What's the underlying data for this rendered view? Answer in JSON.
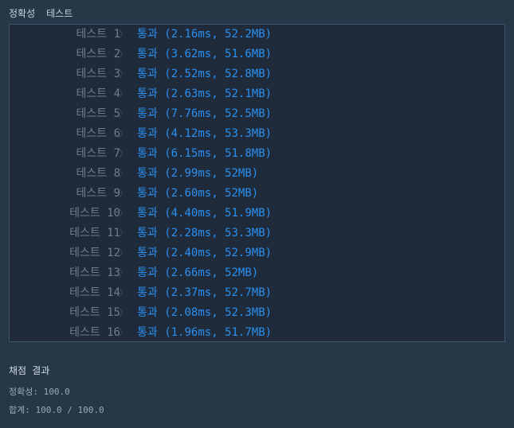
{
  "header": {
    "tabs": [
      "정확성",
      "테스트"
    ]
  },
  "tests": [
    {
      "name": "테스트 1",
      "result": "통과 (2.16ms, 52.2MB)"
    },
    {
      "name": "테스트 2",
      "result": "통과 (3.62ms, 51.6MB)"
    },
    {
      "name": "테스트 3",
      "result": "통과 (2.52ms, 52.8MB)"
    },
    {
      "name": "테스트 4",
      "result": "통과 (2.63ms, 52.1MB)"
    },
    {
      "name": "테스트 5",
      "result": "통과 (7.76ms, 52.5MB)"
    },
    {
      "name": "테스트 6",
      "result": "통과 (4.12ms, 53.3MB)"
    },
    {
      "name": "테스트 7",
      "result": "통과 (6.15ms, 51.8MB)"
    },
    {
      "name": "테스트 8",
      "result": "통과 (2.99ms, 52MB)"
    },
    {
      "name": "테스트 9",
      "result": "통과 (2.60ms, 52MB)"
    },
    {
      "name": "테스트 10",
      "result": "통과 (4.40ms, 51.9MB)"
    },
    {
      "name": "테스트 11",
      "result": "통과 (2.28ms, 53.3MB)"
    },
    {
      "name": "테스트 12",
      "result": "통과 (2.40ms, 52.9MB)"
    },
    {
      "name": "테스트 13",
      "result": "통과 (2.66ms, 52MB)"
    },
    {
      "name": "테스트 14",
      "result": "통과 (2.37ms, 52.7MB)"
    },
    {
      "name": "테스트 15",
      "result": "통과 (2.08ms, 52.3MB)"
    },
    {
      "name": "테스트 16",
      "result": "통과 (1.96ms, 51.7MB)"
    }
  ],
  "chevron": "〉",
  "summary": {
    "title": "채점 결과",
    "accuracy": "정확성: 100.0",
    "total": "합계: 100.0 / 100.0"
  },
  "colors": {
    "background": "#263747",
    "panel": "#1f2b3a",
    "pass": "#2a8ff0",
    "test_name": "#6c7e90"
  }
}
